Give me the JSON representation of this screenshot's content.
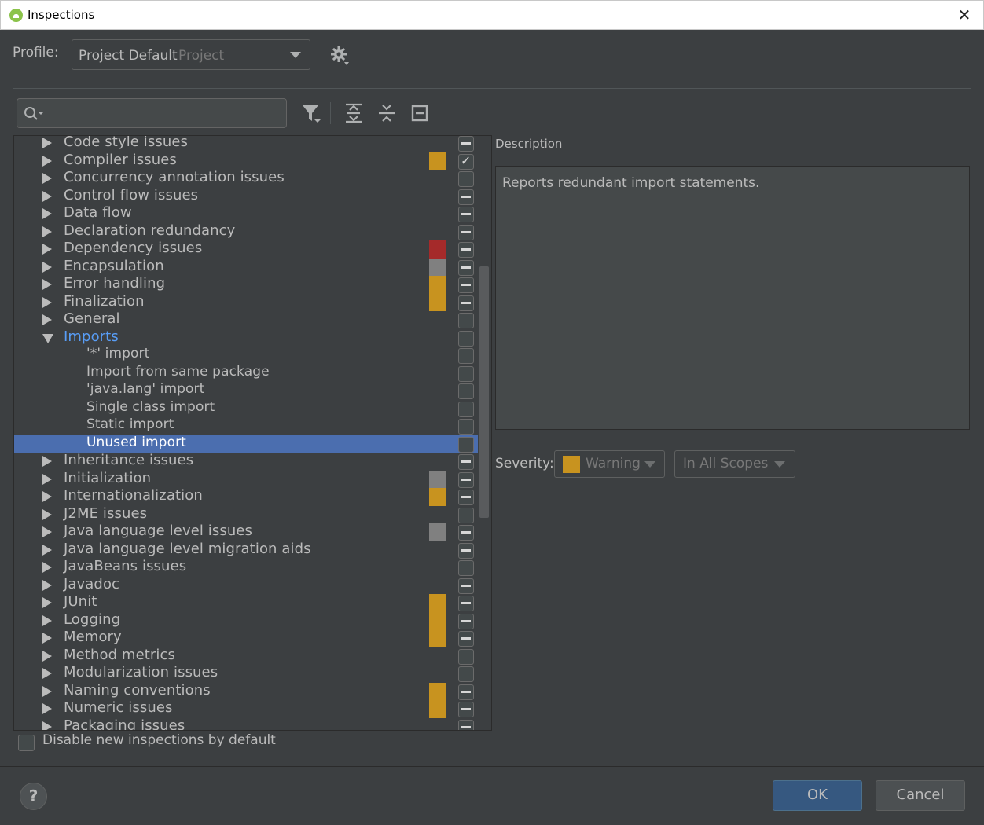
{
  "window": {
    "title": "Inspections",
    "close_icon": "close-icon"
  },
  "profile": {
    "label": "Profile:",
    "name": "Project Default",
    "scope": "Project"
  },
  "search": {
    "placeholder": ""
  },
  "toolbar": {
    "icons": [
      "filter-icon",
      "expand-all-icon",
      "collapse-all-icon",
      "reset-icon"
    ]
  },
  "tree": {
    "rows": [
      {
        "label": "Code style issues",
        "type": "group",
        "severity": [],
        "check": "partial"
      },
      {
        "label": "Compiler issues",
        "type": "group",
        "severity": [
          "#c8931f"
        ],
        "check": "checked"
      },
      {
        "label": "Concurrency annotation issues",
        "type": "group",
        "severity": [],
        "check": "empty"
      },
      {
        "label": "Control flow issues",
        "type": "group",
        "severity": [],
        "check": "partial"
      },
      {
        "label": "Data flow",
        "type": "group",
        "severity": [],
        "check": "partial"
      },
      {
        "label": "Declaration redundancy",
        "type": "group",
        "severity": [],
        "check": "partial"
      },
      {
        "label": "Dependency issues",
        "type": "group",
        "severity": [
          "#a52a2a"
        ],
        "check": "partial"
      },
      {
        "label": "Encapsulation",
        "type": "group",
        "severity": [
          "#808080"
        ],
        "check": "partial"
      },
      {
        "label": "Error handling",
        "type": "group",
        "severity": [
          "#c8931f"
        ],
        "check": "partial"
      },
      {
        "label": "Finalization",
        "type": "group",
        "severity": [
          "#c8931f"
        ],
        "check": "partial"
      },
      {
        "label": "General",
        "type": "group",
        "severity": [],
        "check": "empty"
      },
      {
        "label": "Imports",
        "type": "expanded",
        "severity": [],
        "check": "empty"
      },
      {
        "label": "'*' import",
        "type": "child",
        "severity": [],
        "check": "empty"
      },
      {
        "label": "Import from same package",
        "type": "child",
        "severity": [],
        "check": "empty"
      },
      {
        "label": "'java.lang' import",
        "type": "child",
        "severity": [],
        "check": "empty"
      },
      {
        "label": "Single class import",
        "type": "child",
        "severity": [],
        "check": "empty"
      },
      {
        "label": "Static import",
        "type": "child",
        "severity": [],
        "check": "empty"
      },
      {
        "label": "Unused import",
        "type": "selected",
        "severity": [],
        "check": "empty"
      },
      {
        "label": "Inheritance issues",
        "type": "group",
        "severity": [],
        "check": "partial"
      },
      {
        "label": "Initialization",
        "type": "group",
        "severity": [
          "#808080"
        ],
        "check": "partial"
      },
      {
        "label": "Internationalization",
        "type": "group",
        "severity": [
          "#c8931f"
        ],
        "check": "partial"
      },
      {
        "label": "J2ME issues",
        "type": "group",
        "severity": [],
        "check": "empty"
      },
      {
        "label": "Java language level issues",
        "type": "group",
        "severity": [
          "#808080"
        ],
        "check": "partial"
      },
      {
        "label": "Java language level migration aids",
        "type": "group",
        "severity": [],
        "check": "partial"
      },
      {
        "label": "JavaBeans issues",
        "type": "group",
        "severity": [],
        "check": "empty"
      },
      {
        "label": "Javadoc",
        "type": "group",
        "severity": [],
        "check": "partial"
      },
      {
        "label": "JUnit",
        "type": "group",
        "severity": [
          "#c8931f"
        ],
        "check": "partial"
      },
      {
        "label": "Logging",
        "type": "group",
        "severity": [
          "#c8931f"
        ],
        "check": "partial"
      },
      {
        "label": "Memory",
        "type": "group",
        "severity": [
          "#c8931f"
        ],
        "check": "partial"
      },
      {
        "label": "Method metrics",
        "type": "group",
        "severity": [],
        "check": "empty"
      },
      {
        "label": "Modularization issues",
        "type": "group",
        "severity": [],
        "check": "empty"
      },
      {
        "label": "Naming conventions",
        "type": "group",
        "severity": [
          "#c8931f"
        ],
        "check": "partial"
      },
      {
        "label": "Numeric issues",
        "type": "group",
        "severity": [
          "#c8931f"
        ],
        "check": "partial"
      },
      {
        "label": "Packaging issues",
        "type": "group",
        "severity": [],
        "check": "partial"
      }
    ]
  },
  "description": {
    "title": "Description",
    "text": "Reports redundant import statements."
  },
  "severity": {
    "label": "Severity:",
    "value": "Warning",
    "color": "#c8931f",
    "scope": "In All Scopes"
  },
  "footer": {
    "disable_label": "Disable new inspections by default",
    "help_label": "?",
    "ok_label": "OK",
    "cancel_label": "Cancel"
  }
}
